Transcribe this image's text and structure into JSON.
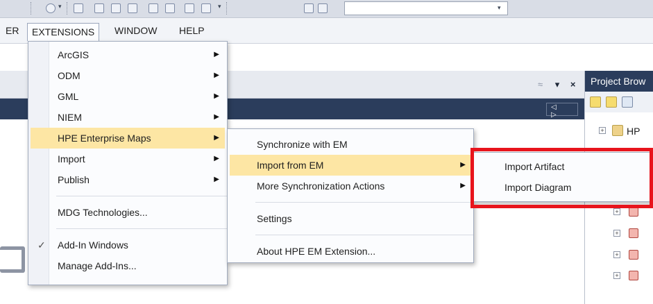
{
  "menubar": {
    "partial_label": "ER",
    "extensions": "EXTENSIONS",
    "window": "WINDOW",
    "help": "HELP"
  },
  "doc_controls": {
    "pin_glyph": "≈",
    "dropdown_glyph": "▾",
    "close_glyph": "×",
    "nav_glyph": "◁ ▷"
  },
  "project_browser": {
    "title": "Project Brow",
    "tree_item_label": "HP"
  },
  "extensions_menu": {
    "items": [
      {
        "label": "ArcGIS",
        "submenu": true
      },
      {
        "label": "ODM",
        "submenu": true
      },
      {
        "label": "GML",
        "submenu": true
      },
      {
        "label": "NIEM",
        "submenu": true
      },
      {
        "label": "HPE Enterprise Maps",
        "submenu": true,
        "highlighted": true
      },
      {
        "label": "Import",
        "submenu": true
      },
      {
        "label": "Publish",
        "submenu": true
      }
    ],
    "mdg": "MDG Technologies...",
    "addin_windows": "Add-In Windows",
    "addin_windows_checked": true,
    "manage_addins": "Manage Add-Ins..."
  },
  "hpe_menu": {
    "sync": "Synchronize with EM",
    "import_from_em": "Import from EM",
    "more_sync": "More Synchronization Actions",
    "settings": "Settings",
    "about": "About HPE EM Extension..."
  },
  "import_menu": {
    "artifact": "Import Artifact",
    "diagram": "Import Diagram"
  },
  "colors": {
    "highlight": "#fde6a4",
    "callout": "#e8141c",
    "header": "#2b3d5c"
  },
  "glyphs": {
    "submenu_arrow": "▶",
    "check": "✓"
  }
}
